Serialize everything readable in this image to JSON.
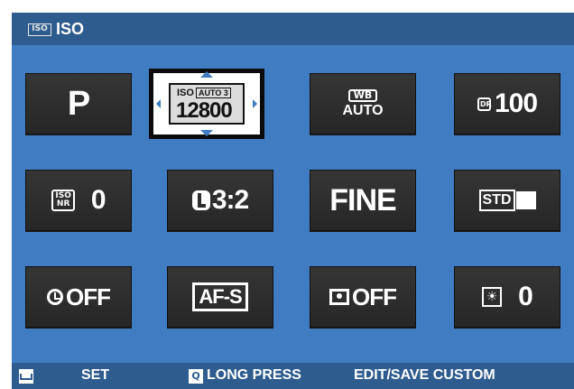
{
  "header": {
    "icon": "ISO",
    "title": "ISO"
  },
  "tiles": {
    "shooting_mode": "P",
    "iso": {
      "label": "ISO",
      "auto": "AUTO 3",
      "value": "12800"
    },
    "wb": {
      "label": "WB",
      "value": "AUTO"
    },
    "dr": {
      "label": "DR",
      "value": "100"
    },
    "noise_reduction": {
      "label_top": "ISO",
      "label_bottom": "NR",
      "value": "0"
    },
    "image_size": {
      "value": "3:2"
    },
    "quality": "FINE",
    "film_sim": {
      "value": "STD"
    },
    "self_timer": {
      "value": "OFF"
    },
    "af_mode": "AF-S",
    "face_detect": {
      "value": "OFF"
    },
    "lcd_brightness": {
      "value": "0"
    }
  },
  "footer": {
    "set_icon": "set-icon",
    "set_label": "SET",
    "q_icon": "Q",
    "long_press_label": "LONG PRESS",
    "edit_label": "EDIT/SAVE CUSTOM"
  },
  "colors": {
    "background": "#3f7cc1",
    "bars": "#2f5c8f",
    "tile": "#2e2e2e",
    "selected_tile": "#ffffff"
  }
}
